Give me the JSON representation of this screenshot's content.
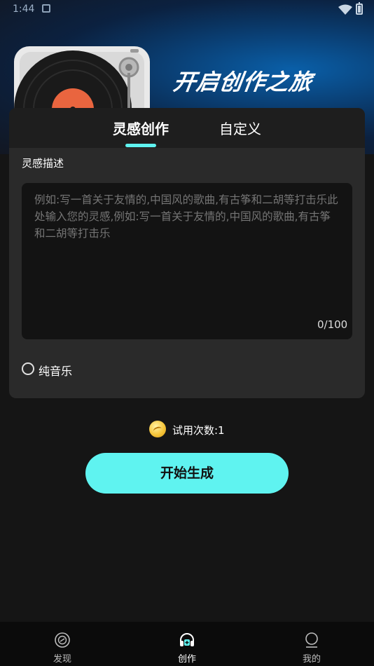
{
  "status_bar": {
    "time": "1:44"
  },
  "hero": {
    "title": "开启创作之旅"
  },
  "tabs": [
    {
      "label": "灵感创作",
      "active": true
    },
    {
      "label": "自定义",
      "active": false
    }
  ],
  "form": {
    "section_label": "灵感描述",
    "placeholder": "例如:写一首关于友情的,中国风的歌曲,有古筝和二胡等打击乐此处输入您的灵感,例如:写一首关于友情的,中国风的歌曲,有古筝和二胡等打击乐",
    "value": "",
    "counter": "0/100",
    "pure_music_label": "纯音乐",
    "pure_music_checked": false
  },
  "trial": {
    "text": "试用次数:1"
  },
  "generate_button": {
    "label": "开始生成"
  },
  "bottom_nav": [
    {
      "label": "发现",
      "icon": "disc-icon",
      "active": false
    },
    {
      "label": "创作",
      "icon": "headphones-icon",
      "active": true
    },
    {
      "label": "我的",
      "icon": "profile-icon",
      "active": false
    }
  ],
  "colors": {
    "accent": "#5ff3f0",
    "background": "#151515",
    "card": "#2a2a2a"
  }
}
